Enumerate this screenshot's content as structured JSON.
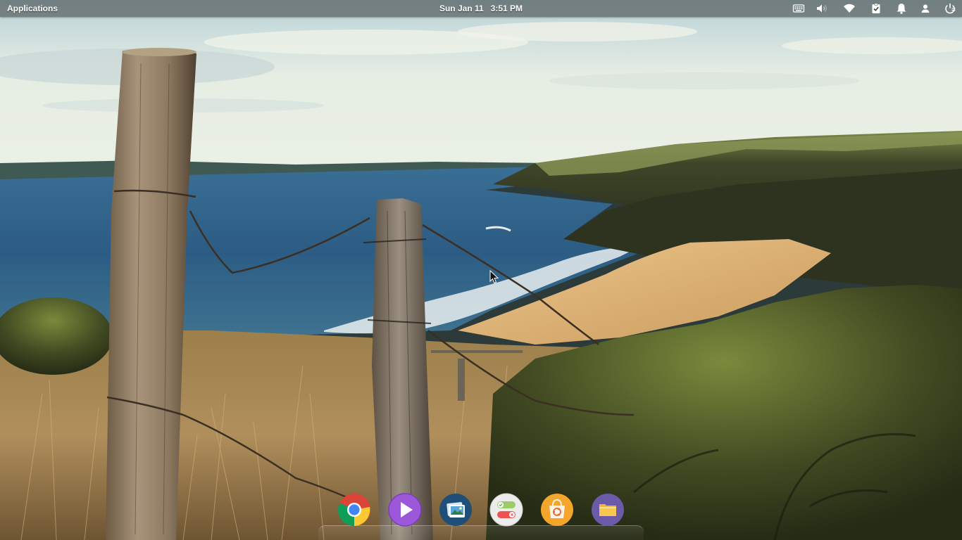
{
  "top_panel": {
    "applications_label": "Applications",
    "clock_date": "Sun Jan 11",
    "clock_time": "3:51 PM",
    "indicators": [
      {
        "name": "keyboard-icon"
      },
      {
        "name": "volume-icon"
      },
      {
        "name": "wifi-icon"
      },
      {
        "name": "clipboard-check-icon"
      },
      {
        "name": "notifications-bell-icon"
      },
      {
        "name": "user-icon"
      },
      {
        "name": "power-icon"
      }
    ]
  },
  "dock": {
    "items": [
      {
        "name": "chrome-icon",
        "app": "Chrome",
        "color": "#4285f4"
      },
      {
        "name": "video-player-icon",
        "app": "Videos",
        "color": "#9b59d9"
      },
      {
        "name": "photos-icon",
        "app": "Photos",
        "color": "#1f5b8a"
      },
      {
        "name": "switchboard-settings-icon",
        "app": "System Settings",
        "color": "#f0f0f0"
      },
      {
        "name": "app-center-icon",
        "app": "Software Center",
        "color": "#f4a52c"
      },
      {
        "name": "files-icon",
        "app": "Files",
        "color": "#6b5aa8"
      }
    ]
  },
  "wallpaper": {
    "description_colors": {
      "sky": "#dfe8e2",
      "sea": "#2f5f86",
      "sand": "#e1b47a",
      "grass": "#a98d5a",
      "shrub": "#3f4a25"
    }
  }
}
